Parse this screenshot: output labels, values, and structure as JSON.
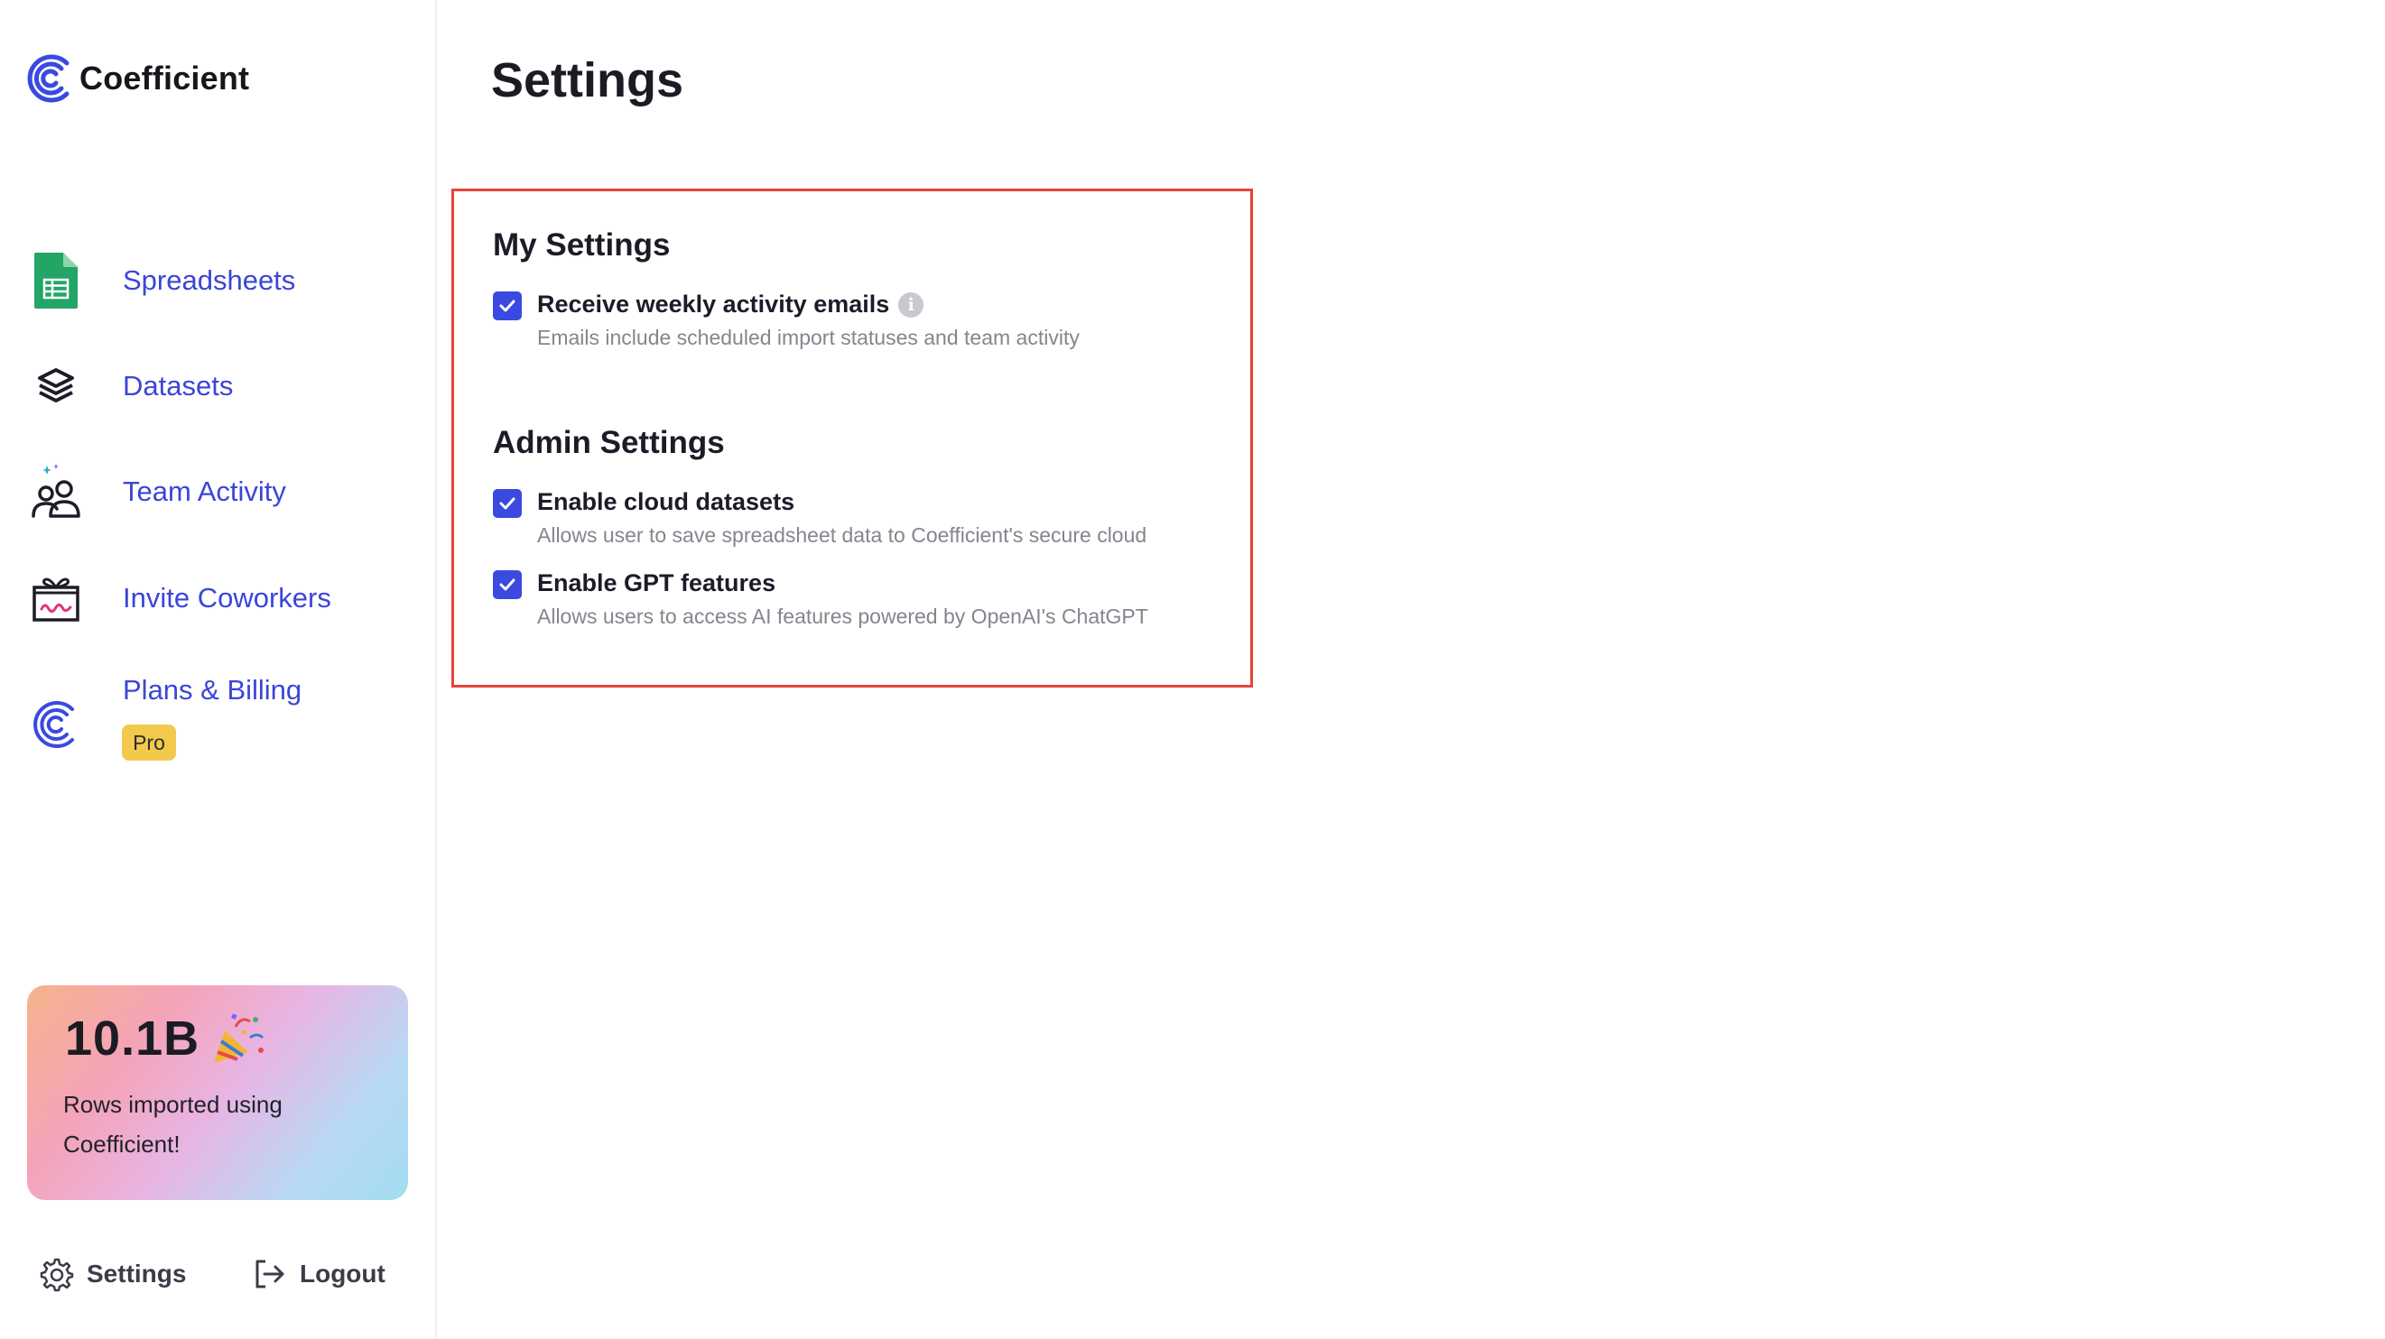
{
  "app": {
    "name": "Coefficient"
  },
  "sidebar": {
    "items": [
      {
        "label": "Spreadsheets",
        "icon": "spreadsheet-icon"
      },
      {
        "label": "Datasets",
        "icon": "datasets-icon"
      },
      {
        "label": "Team Activity",
        "icon": "team-icon"
      },
      {
        "label": "Invite Coworkers",
        "icon": "gift-icon"
      },
      {
        "label": "Plans & Billing",
        "icon": "coefficient-logo-icon",
        "badge": "Pro"
      }
    ],
    "promo": {
      "number": "10.1B",
      "text": "Rows imported using Coefficient!"
    },
    "footer": {
      "settings_label": "Settings",
      "logout_label": "Logout"
    }
  },
  "main": {
    "title": "Settings",
    "my_settings": {
      "title": "My Settings",
      "options": [
        {
          "label": "Receive weekly activity emails",
          "description": "Emails include scheduled import statuses and team activity",
          "checked": true,
          "info": "i"
        }
      ]
    },
    "admin_settings": {
      "title": "Admin Settings",
      "options": [
        {
          "label": "Enable cloud datasets",
          "description": "Allows user to save spreadsheet data to Coefficient's secure cloud",
          "checked": true
        },
        {
          "label": "Enable GPT features",
          "description": "Allows users to access AI features powered by OpenAI's ChatGPT",
          "checked": true
        }
      ]
    }
  },
  "colors": {
    "accent": "#3a4ae0",
    "nav_text": "#3b45d8",
    "highlight_border": "#e5443a",
    "badge": "#f2c94c"
  }
}
